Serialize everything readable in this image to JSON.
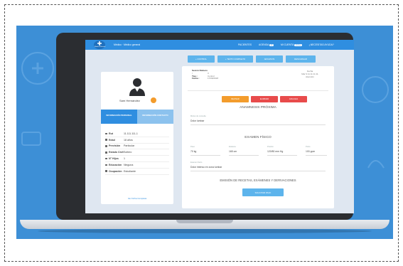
{
  "colors": {
    "scene_bg": "#3d8fd6",
    "topbar": "#2f8ee0",
    "action_button": "#5db4ec",
    "orange": "#f39c2c",
    "red": "#e84b4b",
    "laptop_bezel": "#2b2d31"
  },
  "topbar": {
    "logo_text": "Medical Record",
    "title": "Médico · Médico general",
    "nav": [
      {
        "label": "PACIENTES",
        "badge": ""
      },
      {
        "label": "AGENDA",
        "badge": "23"
      },
      {
        "label": "MI CUENTA",
        "badge": "Online"
      },
      {
        "label": "¿NECESITAS AYUDA?",
        "badge": ""
      }
    ]
  },
  "actions": [
    {
      "label": "+ CONTROL",
      "icon": "plus-icon"
    },
    {
      "label": "+ TEXTO COMPLETO",
      "icon": "plus-icon"
    },
    {
      "label": "ARCHIVOS",
      "icon": "file-icon"
    },
    {
      "label": "DESCARGAR",
      "icon": "download-icon"
    }
  ],
  "patient": {
    "name": "Sam Hernández",
    "tabs": [
      "INFORMACIÓN PERSONAL",
      "INFORMACIÓN CONTACTO"
    ],
    "info": [
      {
        "key": "Rut",
        "value": "11.111.111-1"
      },
      {
        "key": "Edad",
        "value": "18 años"
      },
      {
        "key": "Previsión",
        "value": "Particular"
      },
      {
        "key": "Estado Civil",
        "value": "Soltero"
      },
      {
        "key": "N° Hijos",
        "value": "1"
      },
      {
        "key": "Educación",
        "value": "Ninguna"
      },
      {
        "key": "Ocupación",
        "value": "Estudiante"
      }
    ],
    "more_link": "Ver Ficha Completa"
  },
  "consult": {
    "fields": [
      {
        "label": "Sesión Número :",
        "value": "3"
      },
      {
        "label": "Tipo :",
        "value": "Control"
      },
      {
        "label": "Fecha :",
        "value": "17/09/2018"
      }
    ],
    "right_lines": [
      "Fecha",
      "Mar 9 11 11 11 11",
      "Atención"
    ],
    "buttons": [
      "REVISAR",
      "ELIMINAR",
      "ANULADA"
    ],
    "anamnesis_title": "ANAMNESIS PRÓXIMA",
    "anamnesis_label": "Motivo de consulta",
    "anamnesis_value": "Dolor lumbar",
    "exam_title": "EXAMEN FÍSICO",
    "exam_fields": [
      {
        "label": "Peso",
        "value": "70 kg"
      },
      {
        "label": "Estatura",
        "value": "165 cm"
      },
      {
        "label": "Presión",
        "value": "120/80 mm Hg"
      },
      {
        "label": "Pulso",
        "value": "100 ppm"
      }
    ],
    "other_label": "Examen físico",
    "other_value": "Dolor intenso en zona lumbar",
    "emission_title": "EMISIÓN DE RECETAS, EXÁMENES Y DERIVACIONES",
    "emission_button": "SOLICITAR PACK"
  }
}
